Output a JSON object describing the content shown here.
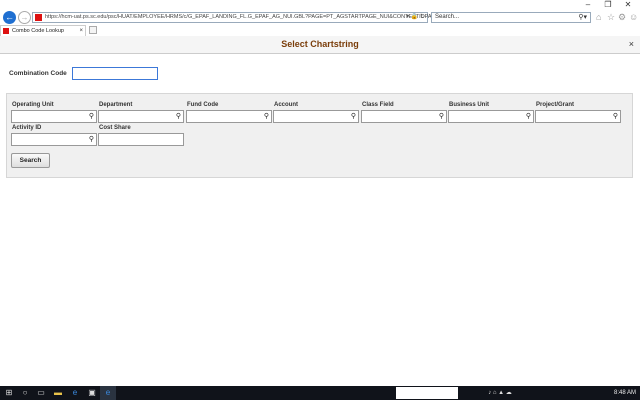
{
  "browser": {
    "url": "https://hcm-uat.ps.sc.edu/psc/HUAT/EMPLOYEE/HRMS/c/G_EPAF_LANDING_FL.G_EPAF_AG_NUI.GBL?PAGE=PT_AGSTARTPAGE_NUI&CONTEXTIDPARAM",
    "search_placeholder": "Search...",
    "tab_title": "Combo Code Lookup"
  },
  "modal": {
    "title": "Select Chartstring",
    "close_glyph": "×"
  },
  "combination_code": {
    "label": "Combination Code",
    "value": ""
  },
  "fields": [
    {
      "label": "Operating Unit",
      "value": ""
    },
    {
      "label": "Department",
      "value": ""
    },
    {
      "label": "Fund Code",
      "value": ""
    },
    {
      "label": "Account",
      "value": ""
    },
    {
      "label": "Class Field",
      "value": ""
    },
    {
      "label": "Business Unit",
      "value": ""
    },
    {
      "label": "Project/Grant",
      "value": ""
    },
    {
      "label": "Activity ID",
      "value": ""
    },
    {
      "label": "Cost Share",
      "value": ""
    }
  ],
  "search_button": {
    "label": "Search"
  },
  "taskbar": {
    "clock": "8:48 AM"
  },
  "icons": {
    "back": "←",
    "forward": "→",
    "search": "⚲",
    "close": "×",
    "home": "⌂",
    "star": "☆",
    "gear": "⚙",
    "smiley": "☺"
  },
  "colors": {
    "title": "#7a3d0a",
    "accent": "#1f6fd1"
  }
}
